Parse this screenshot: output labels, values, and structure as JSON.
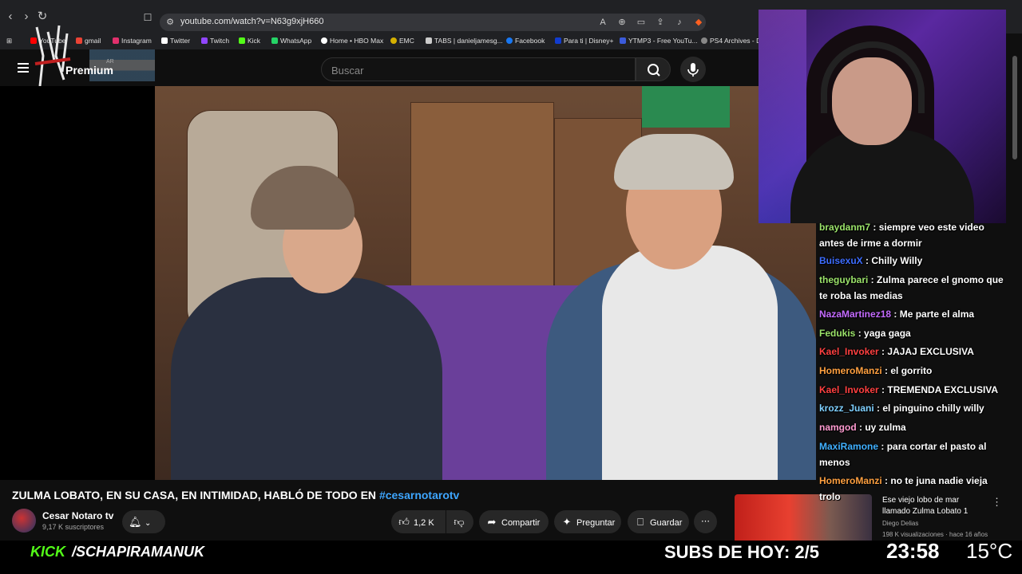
{
  "browser": {
    "url": "youtube.com/watch?v=N63g9xjH660",
    "bookmarks": [
      {
        "label": "YouTube",
        "color": "#ff0000"
      },
      {
        "label": "gmail",
        "color": "#ea4335"
      },
      {
        "label": "Instagram",
        "color": "#e1306c"
      },
      {
        "label": "Twitter",
        "color": "#ffffff"
      },
      {
        "label": "Twitch",
        "color": "#9146ff"
      },
      {
        "label": "Kick",
        "color": "#53fc18"
      },
      {
        "label": "WhatsApp",
        "color": "#25d366"
      },
      {
        "label": "Home • HBO Max",
        "color": "#ffffff"
      },
      {
        "label": "EMC",
        "color": "#d4b000"
      },
      {
        "label": "TABS | danieljamesg...",
        "color": "#cccccc"
      },
      {
        "label": "Facebook",
        "color": "#1877f2"
      },
      {
        "label": "Para ti | Disney+",
        "color": "#113ccf"
      },
      {
        "label": "YTMP3 - Free YouTu...",
        "color": "#3b5bdb"
      },
      {
        "label": "PS4 Archives - D",
        "color": "#888888"
      }
    ]
  },
  "yt_header": {
    "brand": "Premium",
    "country": "AR",
    "search_placeholder": "Buscar"
  },
  "video": {
    "title": "ZULMA LOBATO, EN SU CASA, EN INTIMIDAD, HABLÓ DE TODO EN",
    "hashtag": "#cesarnotarotv",
    "channel": "Cesar Notaro tv",
    "subscribers": "9,17 K suscriptores",
    "likes": "1,2 K",
    "share_label": "Compartir",
    "ask_label": "Preguntar",
    "save_label": "Guardar"
  },
  "recommendation": {
    "title_line1": "Ese viejo lobo de mar",
    "title_line2": "llamado Zulma Lobato 1",
    "author": "Diego Delias",
    "meta": "198 K visualizaciones · hace 16 años"
  },
  "chat": [
    {
      "user": "braydanm7",
      "color": "#9be36a",
      "text": "siempre veo este video antes de irme a dormir"
    },
    {
      "user": "BuisexuX",
      "color": "#3d6dff",
      "text": "Chilly Willy"
    },
    {
      "user": "theguybari",
      "color": "#9be36a",
      "text": "Zulma parece el gnomo que te roba las medias"
    },
    {
      "user": "NazaMartinez18",
      "color": "#c46bff",
      "text": "Me parte el alma"
    },
    {
      "user": "Fedukis",
      "color": "#9be36a",
      "text": "yaga gaga"
    },
    {
      "user": "Kael_Invoker",
      "color": "#ff4040",
      "text": "JAJAJ EXCLUSIVA"
    },
    {
      "user": "HomeroManzi",
      "color": "#ffa040",
      "text": "el gorrito"
    },
    {
      "user": "Kael_Invoker",
      "color": "#ff4040",
      "text": "TREMENDA EXCLUSIVA"
    },
    {
      "user": "krozz_Juani",
      "color": "#7fd0ff",
      "text": "el pinguino chilly willy"
    },
    {
      "user": "namgod",
      "color": "#ff9bd0",
      "text": "uy zulma"
    },
    {
      "user": "MaxiRamone",
      "color": "#40b0ff",
      "text": "para cortar el pasto al menos"
    },
    {
      "user": "HomeroManzi",
      "color": "#ffa040",
      "text": "no te juna nadie vieja trolo"
    }
  ],
  "overlay": {
    "kick_label": "KICK",
    "kick_handle": "/SCHAPIRAMANUK",
    "subs_today": "SUBS DE HOY: 2/5",
    "clock": "23:58",
    "temperature": "15°C"
  }
}
